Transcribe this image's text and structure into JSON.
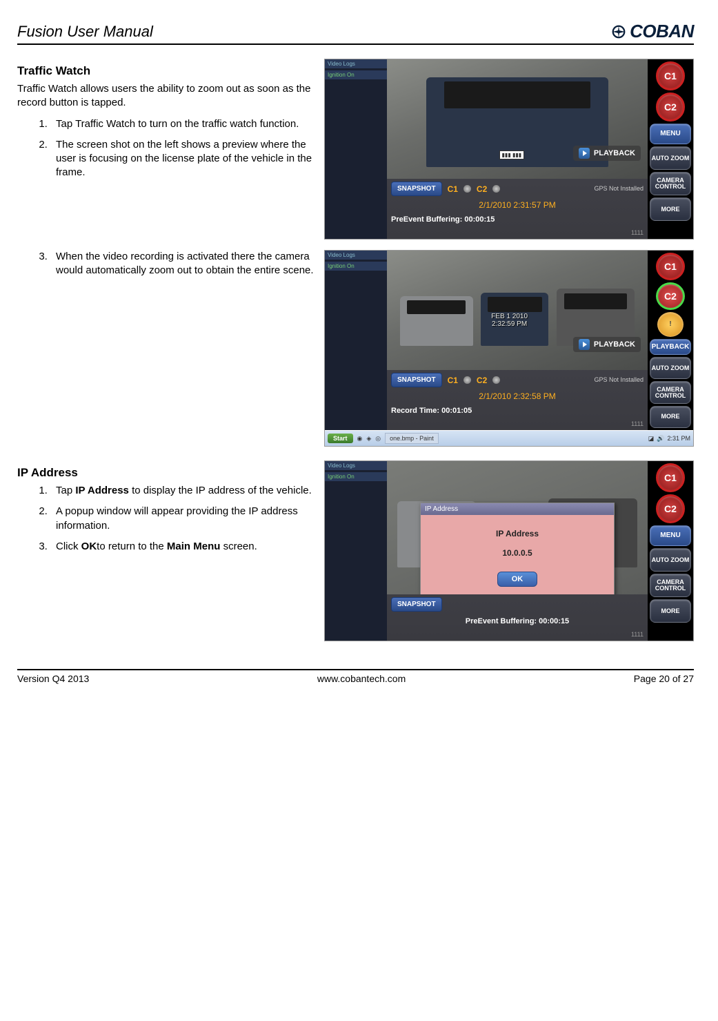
{
  "header": {
    "title": "Fusion User Manual",
    "logoText": "COBAN"
  },
  "section1": {
    "heading": "Traffic Watch",
    "intro": "Traffic Watch allows users the ability to zoom out as soon as the record button is tapped.",
    "step1": "Tap Traffic Watch to turn on the traffic watch function.",
    "step2": "The screen shot on the left shows a preview where the user is focusing on the license plate of the vehicle in the frame.",
    "step3": "When the video recording is activated there the camera would automatically zoom out to obtain the entire scene."
  },
  "section2": {
    "heading": "IP Address",
    "step1_a": "Tap ",
    "step1_b": "IP Address",
    "step1_c": " to display the IP address of the vehicle.",
    "step2": "A popup window will appear providing the IP address information.",
    "step3_a": "Click ",
    "step3_b": "OK",
    "step3_c": "to return to the ",
    "step3_d": "Main Menu",
    "step3_e": " screen."
  },
  "screenshot_common": {
    "videoLogs": "Video Logs",
    "ignition": "Ignition On",
    "c1": "C1",
    "c2": "C2",
    "menu": "MENU",
    "autoZoom": "AUTO ZOOM",
    "cameraControl": "CAMERA CONTROL",
    "more": "MORE",
    "playback": "PLAYBACK",
    "snapshot": "SNAPSHOT",
    "gps": "GPS Not Installed",
    "signal": "1111"
  },
  "shot1": {
    "timestamp": "2/1/2010 2:31:57 PM",
    "status": "PreEvent Buffering: 00:00:15"
  },
  "shot2": {
    "overlayDate": "FEB   1 2010",
    "overlayTime": "2:32:59 PM",
    "timestamp": "2/1/2010 2:32:58 PM",
    "status": "Record Time: 00:01:05",
    "taskbarStart": "Start",
    "taskbarApp": "one.bmp - Paint",
    "taskbarTime": "2:31 PM"
  },
  "shot3": {
    "popupTitle": "IP Address",
    "popupLabel": "IP Address",
    "popupValue": "10.0.0.5",
    "ok": "OK",
    "status": "PreEvent Buffering: 00:00:15"
  },
  "footer": {
    "version": "Version Q4 2013",
    "url": "www.cobantech.com",
    "page": "Page 20 of 27"
  }
}
